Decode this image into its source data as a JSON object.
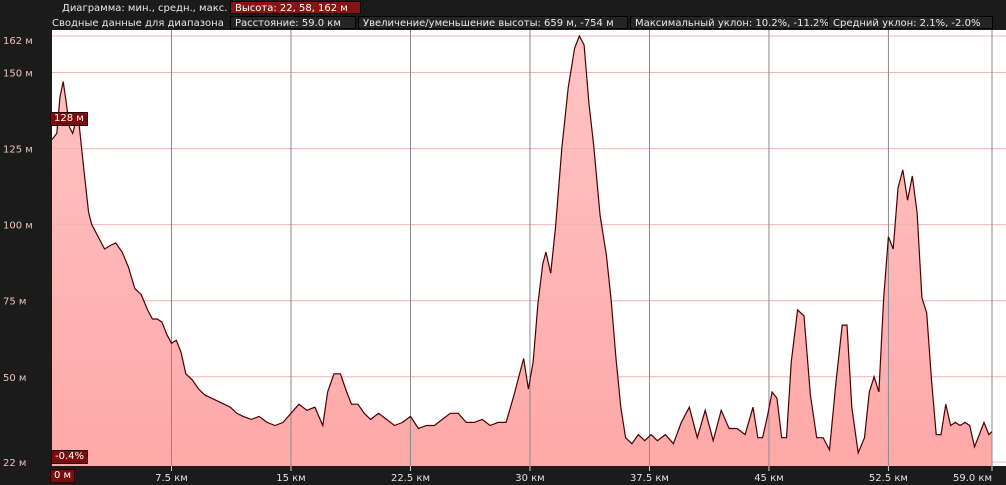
{
  "header": {
    "diagram_label": "Диаграмма: мин., средн., макс.",
    "diagram_value": "Высота: 22, 58, 162 м",
    "summary_label": "Сводные данные для диапазона",
    "distance": "Расстояние: 59.0 км",
    "gain_loss": "Увеличение/уменьшение высоты: 659 м, -754 м",
    "max_slope": "Максимальный уклон: 10.2%, -11.2%",
    "avg_slope": "Средний уклон: 2.1%, -2.0%"
  },
  "markers": {
    "elevation": "128 м",
    "slope": "-0.4%",
    "distance": "0 м"
  },
  "colors": {
    "accent": "#8b1212",
    "fill_top": "#ffc6c6",
    "line": "#4a0000",
    "background": "#ffffff"
  },
  "chart_data": {
    "type": "area",
    "title": "",
    "xlabel": "",
    "ylabel": "",
    "xlim": [
      0,
      59.0
    ],
    "ylim": [
      22,
      162
    ],
    "grid": true,
    "y_ticks": [
      {
        "value": 162,
        "label": "162 м"
      },
      {
        "value": 150,
        "label": "150 м"
      },
      {
        "value": 125,
        "label": "125 м"
      },
      {
        "value": 100,
        "label": "100 м"
      },
      {
        "value": 75,
        "label": "75 м"
      },
      {
        "value": 50,
        "label": "50 м"
      },
      {
        "value": 22,
        "label": "22 м"
      }
    ],
    "x_ticks": [
      {
        "value": 7.5,
        "label": "7.5 км"
      },
      {
        "value": 15,
        "label": "15 км"
      },
      {
        "value": 22.5,
        "label": "22.5 км"
      },
      {
        "value": 30,
        "label": "30 км"
      },
      {
        "value": 37.5,
        "label": "37.5 км"
      },
      {
        "value": 45,
        "label": "45 км"
      },
      {
        "value": 52.5,
        "label": "52.5 км"
      },
      {
        "value": 59,
        "label": "59.0 км"
      }
    ],
    "x_unit": "км",
    "y_unit": "м",
    "series": [
      {
        "x": [
          0.0,
          0.3,
          0.5,
          0.7,
          0.9,
          1.1,
          1.3,
          1.5,
          1.7,
          2.0,
          2.3,
          2.5,
          2.7,
          3.0,
          3.3,
          3.6,
          4.0,
          4.4,
          4.8,
          5.2,
          5.6,
          6.0,
          6.3,
          6.6,
          6.9,
          7.2,
          7.5,
          7.8,
          8.1,
          8.4,
          8.8,
          9.2,
          9.6,
          10.0,
          10.4,
          10.8,
          11.2,
          11.6,
          12.0,
          12.5,
          13.0,
          13.5,
          14.0,
          14.5,
          15.0,
          15.5,
          16.0,
          16.5,
          17.0,
          17.3,
          17.7,
          18.1,
          18.5,
          18.8,
          19.2,
          19.6,
          20.0,
          20.5,
          21.0,
          21.5,
          22.0,
          22.5,
          23.0,
          23.5,
          24.0,
          24.5,
          25.0,
          25.5,
          26.0,
          26.5,
          27.0,
          27.5,
          28.0,
          28.5,
          29.0,
          29.3,
          29.6,
          29.9,
          30.2,
          30.5,
          30.8,
          31.0,
          31.3,
          31.6,
          32.0,
          32.4,
          32.8,
          33.1,
          33.4,
          33.7,
          34.0,
          34.4,
          34.8,
          35.1,
          35.4,
          35.7,
          36.0,
          36.4,
          36.8,
          37.2,
          37.6,
          38.0,
          38.5,
          39.0,
          39.5,
          40.0,
          40.5,
          41.0,
          41.5,
          42.0,
          42.5,
          43.0,
          43.5,
          44.0,
          44.3,
          44.6,
          44.9,
          45.2,
          45.5,
          45.8,
          46.1,
          46.4,
          46.8,
          47.2,
          47.6,
          48.0,
          48.4,
          48.8,
          49.2,
          49.6,
          49.9,
          50.2,
          50.6,
          51.0,
          51.3,
          51.6,
          51.9,
          52.2,
          52.5,
          52.8,
          53.1,
          53.4,
          53.7,
          54.0,
          54.3,
          54.6,
          54.9,
          55.2,
          55.5,
          55.8,
          56.1,
          56.4,
          56.7,
          57.0,
          57.3,
          57.6,
          57.9,
          58.2,
          58.5,
          58.8,
          59.0
        ],
        "values": [
          128,
          130,
          142,
          147,
          140,
          132,
          130,
          134,
          133,
          118,
          104,
          100,
          98,
          95,
          92,
          93,
          94,
          91,
          86,
          79,
          77,
          72,
          69,
          69,
          68,
          64,
          61,
          62,
          58,
          51,
          49,
          46,
          44,
          43,
          42,
          41,
          40,
          38,
          37,
          36,
          37,
          35,
          34,
          35,
          38,
          41,
          39,
          40,
          34,
          45,
          51,
          51,
          45,
          41,
          41,
          38,
          36,
          38,
          36,
          34,
          35,
          37,
          33,
          34,
          34,
          36,
          38,
          38,
          35,
          35,
          36,
          34,
          35,
          35,
          44,
          50,
          56,
          46,
          55,
          74,
          87,
          91,
          84,
          99,
          125,
          145,
          158,
          162,
          159,
          140,
          126,
          103,
          90,
          75,
          56,
          40,
          30,
          28,
          31,
          29,
          31,
          29,
          31,
          28,
          35,
          40,
          30,
          39,
          29,
          39,
          33,
          33,
          31,
          40,
          30,
          30,
          37,
          45,
          43,
          30,
          30,
          55,
          72,
          70,
          44,
          30,
          30,
          26,
          48,
          67,
          67,
          40,
          25,
          30,
          45,
          50,
          45,
          76,
          96,
          92,
          112,
          118,
          108,
          116,
          104,
          76,
          71,
          49,
          31,
          31,
          41,
          34,
          35,
          34,
          35,
          34,
          27,
          31,
          35,
          31,
          32
        ]
      }
    ]
  }
}
